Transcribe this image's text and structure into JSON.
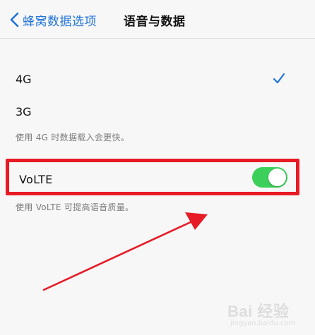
{
  "nav": {
    "back_label": "蜂窝数据选项",
    "title": "语音与数据"
  },
  "options": [
    {
      "label": "4G",
      "selected": true
    },
    {
      "label": "3G",
      "selected": false
    }
  ],
  "hint_network": "使用 4G 时数据载入会更快。",
  "volte": {
    "label": "VoLTE",
    "enabled": true,
    "hint": "使用 VoLTE 可提高语音质量。"
  },
  "colors": {
    "link_blue": "#1f73d8",
    "toggle_on": "#3cd05a",
    "annotation_red": "#e61b25"
  },
  "icons": {
    "back": "chevron-left-icon",
    "selected": "checkmark-icon"
  },
  "watermark": {
    "logo": "Bai 经验",
    "sub": "jingyan.baidu.com"
  }
}
